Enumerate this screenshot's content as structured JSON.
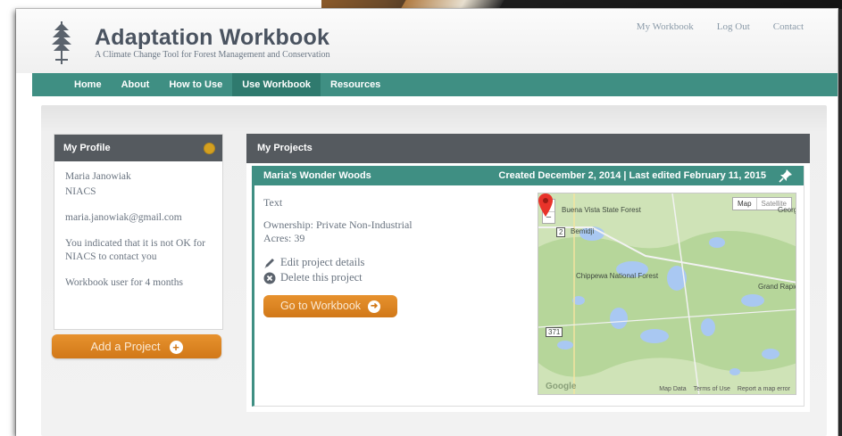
{
  "header": {
    "title": "Adaptation Workbook",
    "subtitle": "A Climate Change Tool for Forest Management and Conservation",
    "top_links": [
      "My Workbook",
      "Log Out",
      "Contact"
    ]
  },
  "nav": {
    "items": [
      "Home",
      "About",
      "How to Use",
      "Use Workbook",
      "Resources"
    ],
    "active": "Use Workbook"
  },
  "profile": {
    "title": "My Profile",
    "name": "Maria Janowiak",
    "org": "NIACS",
    "email": "maria.janowiak@gmail.com",
    "contact_note": "You indicated that it is not OK for NIACS to contact you",
    "user_since": "Workbook user for 4 months",
    "add_button": "Add a Project"
  },
  "projects": {
    "title": "My Projects",
    "card": {
      "name": "Maria's Wonder Woods",
      "dates": "Created December 2, 2014 | Last edited February 11, 2015",
      "description": "Text",
      "ownership": "Ownership: Private Non-Industrial",
      "acres": "Acres: 39",
      "edit_label": "Edit project details",
      "delete_label": "Delete this project",
      "goto_label": "Go to Workbook"
    }
  },
  "map": {
    "zoom_in": "+",
    "zoom_out": "−",
    "type_map": "Map",
    "type_satellite": "Satellite",
    "labels": {
      "state_forest": "Buena Vista State Forest",
      "bemidji": "Bemidji",
      "national_forest": "Chippewa National Forest",
      "grand_rapids": "Grand Rapids",
      "george": "George",
      "hwy": "2",
      "hwy2": "371"
    },
    "footer": [
      "Map Data",
      "Terms of Use",
      "Report a map error"
    ],
    "google": "Google",
    "colors": {
      "land": "#cfe3b7",
      "forest": "#b6d69a",
      "water": "#a9c8f2",
      "pin": "#e8332a"
    }
  },
  "colors": {
    "teal": "#3f8f83",
    "orange": "#e08628",
    "panel_header": "#555a5f"
  }
}
